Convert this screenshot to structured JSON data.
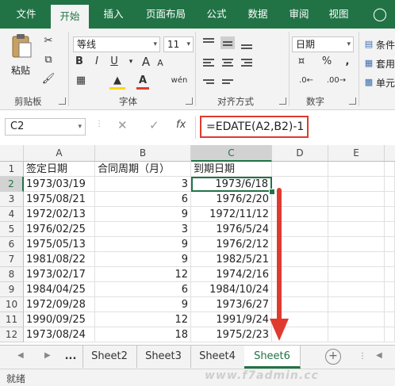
{
  "ribbon_tabs": [
    "文件",
    "开始",
    "插入",
    "页面布局",
    "公式",
    "数据",
    "审阅",
    "视图"
  ],
  "tell_me_icon": "lightbulb-icon",
  "clipboard": {
    "paste_label": "粘贴",
    "group_label": "剪贴板"
  },
  "font": {
    "name": "等线",
    "size": "11",
    "group_label": "字体",
    "bold": "B",
    "italic": "I",
    "underline": "U",
    "grow": "A",
    "shrink": "A",
    "phonetic": "wén"
  },
  "alignment": {
    "group_label": "对齐方式"
  },
  "number": {
    "format": "日期",
    "group_label": "数字",
    "percent": "%",
    "comma": ","
  },
  "styles": {
    "conditional": "条件",
    "table": "套用",
    "cell": "单元"
  },
  "formula_bar": {
    "name_box": "C2",
    "fx": "fx",
    "formula": "=EDATE(A2,B2)-1"
  },
  "columns": [
    "A",
    "B",
    "C",
    "D",
    "E"
  ],
  "rows": [
    {
      "n": "1",
      "a": "签定日期",
      "b": "合同周期（月）",
      "c": "到期日期"
    },
    {
      "n": "2",
      "a": "1973/03/19",
      "b": "3",
      "c": "1973/6/18"
    },
    {
      "n": "3",
      "a": "1975/08/21",
      "b": "6",
      "c": "1976/2/20"
    },
    {
      "n": "4",
      "a": "1972/02/13",
      "b": "9",
      "c": "1972/11/12"
    },
    {
      "n": "5",
      "a": "1976/02/25",
      "b": "3",
      "c": "1976/5/24"
    },
    {
      "n": "6",
      "a": "1975/05/13",
      "b": "9",
      "c": "1976/2/12"
    },
    {
      "n": "7",
      "a": "1981/08/22",
      "b": "9",
      "c": "1982/5/21"
    },
    {
      "n": "8",
      "a": "1973/02/17",
      "b": "12",
      "c": "1974/2/16"
    },
    {
      "n": "9",
      "a": "1984/04/25",
      "b": "6",
      "c": "1984/10/24"
    },
    {
      "n": "10",
      "a": "1972/09/28",
      "b": "9",
      "c": "1973/6/27"
    },
    {
      "n": "11",
      "a": "1990/09/25",
      "b": "12",
      "c": "1991/9/24"
    },
    {
      "n": "12",
      "a": "1973/08/24",
      "b": "18",
      "c": "1975/2/23"
    }
  ],
  "sheets": [
    "...",
    "Sheet2",
    "Sheet3",
    "Sheet4",
    "Sheet6"
  ],
  "status": "就绪",
  "watermark": "www.f7admin.cc",
  "colors": {
    "accent": "#217346",
    "highlight_box": "#e03a2f",
    "arrow": "#e03a2f"
  }
}
